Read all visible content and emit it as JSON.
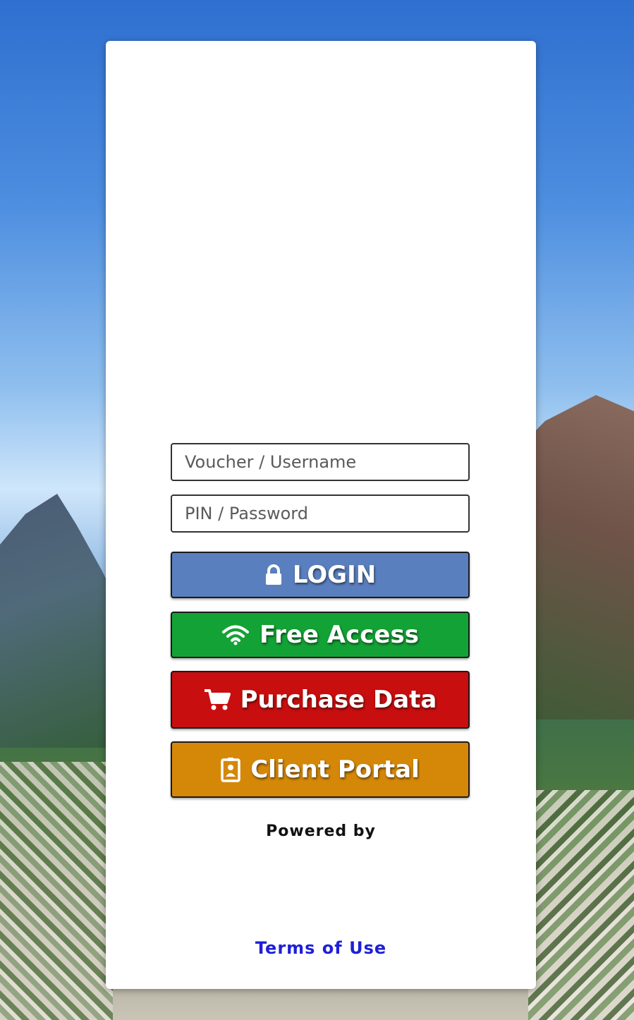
{
  "colors": {
    "login": "#5a7fbe",
    "free_access": "#13a235",
    "purchase_data": "#c80e0e",
    "client_portal": "#d58808",
    "terms_link": "#1f1fd8"
  },
  "form": {
    "username_placeholder": "Voucher / Username",
    "username_value": "",
    "password_placeholder": "PIN / Password",
    "password_value": ""
  },
  "buttons": {
    "login": {
      "label": "LOGIN",
      "icon": "lock-icon"
    },
    "free_access": {
      "label": "Free Access",
      "icon": "wifi-icon"
    },
    "purchase_data": {
      "label": "Purchase Data",
      "icon": "cart-icon"
    },
    "client_portal": {
      "label": "Client Portal",
      "icon": "badge-icon"
    }
  },
  "footer": {
    "powered_by": "Powered by",
    "terms_label": "Terms of Use"
  }
}
